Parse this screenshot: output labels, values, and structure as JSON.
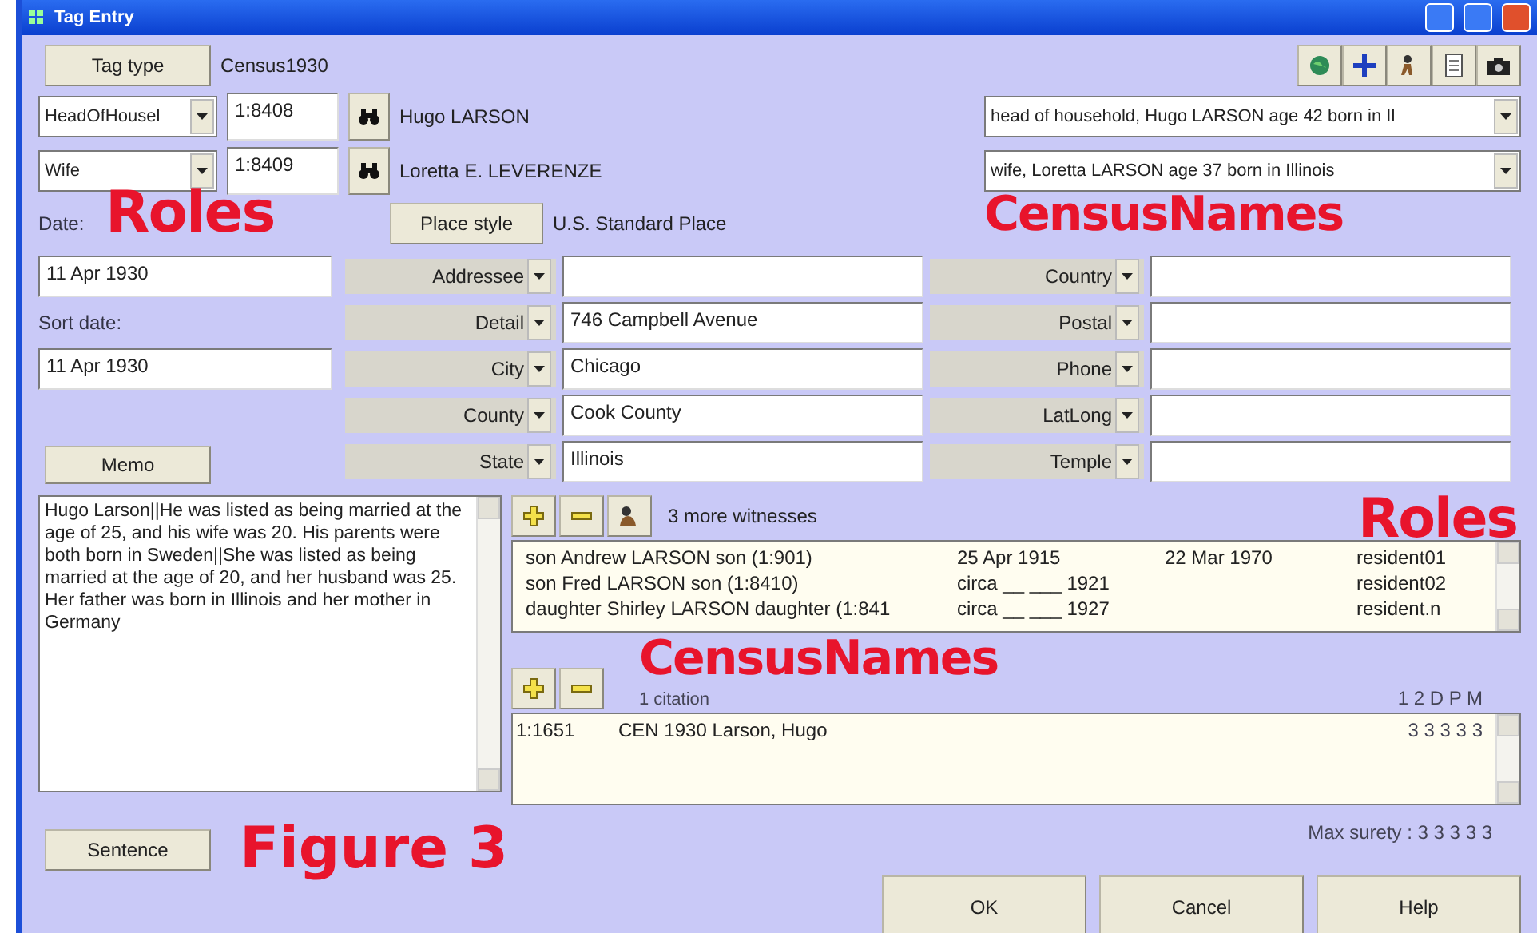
{
  "window": {
    "title": "Tag Entry"
  },
  "tag_type": {
    "button": "Tag type",
    "value": "Census1930"
  },
  "principals": [
    {
      "role": "HeadOfHousel",
      "id": "1:8408",
      "name": "Hugo LARSON",
      "census_name": "head of household, Hugo LARSON age 42 born in Il"
    },
    {
      "role": "Wife",
      "id": "1:8409",
      "name": "Loretta E. LEVERENZE",
      "census_name": "wife, Loretta LARSON age 37 born in Illinois"
    }
  ],
  "date": {
    "label": "Date:",
    "value": "11 Apr 1930"
  },
  "sort_date": {
    "label": "Sort date:",
    "value": "11 Apr 1930"
  },
  "place_style": {
    "button": "Place style",
    "value": "U.S. Standard Place"
  },
  "place_fields": [
    {
      "label": "Addressee"
    },
    {
      "label": "Detail",
      "value": "746 Campbell Avenue"
    },
    {
      "label": "City",
      "value": "Chicago"
    },
    {
      "label": "County",
      "value": "Cook County"
    },
    {
      "label": "State",
      "value": "Illinois"
    }
  ],
  "place_fields_right": [
    {
      "label": "Country"
    },
    {
      "label": "Postal"
    },
    {
      "label": "Phone"
    },
    {
      "label": "LatLong"
    },
    {
      "label": "Temple"
    }
  ],
  "memo": {
    "button": "Memo",
    "text": "Hugo Larson||He was listed as being married at the age of 25, and his wife was 20.  His parents were both born in Sweden||She was listed as being married at the age of 20, and her husband was 25.  Her father was born in Illinois and her mother in Germany"
  },
  "witnesses": {
    "summary": "3 more witnesses",
    "rows": [
      {
        "name": "son Andrew LARSON son (1:901)",
        "date_1": "25 Apr 1915",
        "date_2": "22 Mar 1970",
        "role": "resident01"
      },
      {
        "name": "son Fred LARSON son (1:8410)",
        "date_1": "circa __ ___ 1921",
        "role": "resident02"
      },
      {
        "name": "daughter Shirley LARSON daughter (1:841",
        "date_1": "circa __ ___ 1927",
        "role": "resident.n"
      }
    ]
  },
  "citations": {
    "summary": "1  citation",
    "surety_header": "1 2 D P M",
    "rows": [
      {
        "id": "1:1651",
        "title": "CEN 1930 Larson, Hugo",
        "surety": "3 3 3 3 3"
      }
    ]
  },
  "sentence_button": "Sentence",
  "max_surety": "Max surety : 3  3 3 3 3",
  "buttons": [
    "OK",
    "Cancel",
    "Help"
  ],
  "annotations": [
    {
      "text": "Roles"
    },
    {
      "text": "CensusNames"
    },
    {
      "text": "Roles"
    },
    {
      "text": "CensusNames"
    },
    {
      "text": "Figure 3"
    }
  ]
}
